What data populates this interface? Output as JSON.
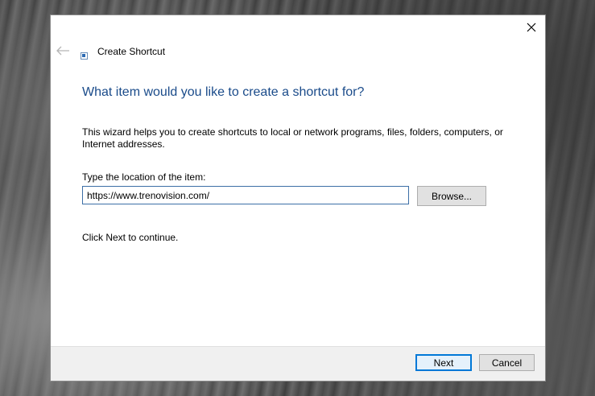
{
  "window": {
    "title": "Create Shortcut",
    "close_icon": "close-icon",
    "back_icon": "back-arrow-icon",
    "app_icon": "shortcut-icon"
  },
  "main": {
    "heading": "What item would you like to create a shortcut for?",
    "description": "This wizard helps you to create shortcuts to local or network programs, files, folders, computers, or Internet addresses.",
    "field_label": "Type the location of the item:",
    "location_value": "https://www.trenovision.com/",
    "browse_label": "Browse...",
    "continue_text": "Click Next to continue."
  },
  "footer": {
    "next_label": "Next",
    "cancel_label": "Cancel"
  },
  "colors": {
    "heading": "#1a4b8a",
    "focus_border": "#0078d7"
  }
}
